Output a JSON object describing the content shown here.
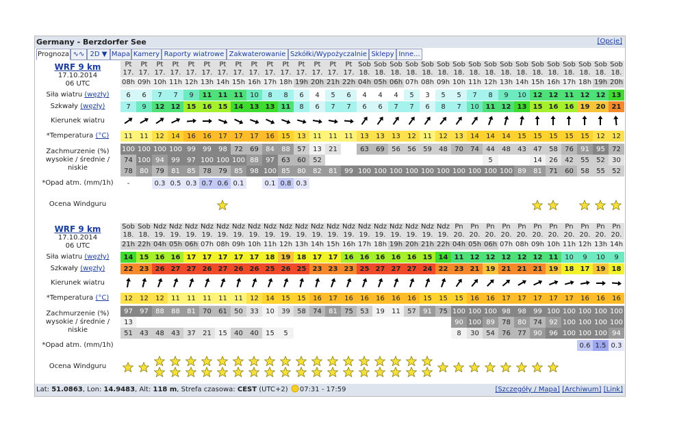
{
  "header": {
    "location": "Germany - Berzdorfer See",
    "options_link": "[Opcje]"
  },
  "tabs": [
    {
      "label": "Prognoza",
      "w": 48,
      "active": true
    },
    {
      "label": "∿∿",
      "w": 22,
      "active": false
    },
    {
      "label": "2D ▼",
      "w": 32,
      "active": false
    },
    {
      "label": "Mapa",
      "w": 29,
      "active": false
    },
    {
      "label": "Kamery",
      "w": 42,
      "active": false
    },
    {
      "label": "Raporty wiatrowe",
      "w": 93,
      "active": false
    },
    {
      "label": "Zakwaterowanie",
      "w": 88,
      "active": false
    },
    {
      "label": "Szkółki/Wypożyczalnie",
      "w": 116,
      "active": false
    },
    {
      "label": "Sklepy",
      "w": 38,
      "active": false
    },
    {
      "label": "Inne...",
      "w": 36,
      "active": false
    }
  ],
  "labels": {
    "wind": "Siła wiatru",
    "wind_unit": "(węzły)",
    "gust": "Szkwały",
    "gust_unit": "(węzły)",
    "dir": "Kierunek wiatru",
    "temp": "*Temperatura",
    "temp_unit": "(°C)",
    "cloud1": "Zachmurzenie (%)",
    "cloud2": "wysokie / średnie / niskie",
    "precip": "*Opad atm. (mm/1h)",
    "rating": "Ocena Windguru"
  },
  "blocks": [
    {
      "model": "WRF 9 km",
      "date": "17.10.2014",
      "run": "06 UTC",
      "days": [
        "Pt",
        "Pt",
        "Pt",
        "Pt",
        "Pt",
        "Pt",
        "Pt",
        "Pt",
        "Pt",
        "Pt",
        "Pt",
        "Pt",
        "Pt",
        "Pt",
        "Pt",
        "Sob",
        "Sob",
        "Sob",
        "Sob",
        "Sob",
        "Sob",
        "Sob",
        "Sob",
        "Sob",
        "Sob",
        "Sob",
        "Sob",
        "Sob",
        "Sob",
        "Sob",
        "Sob",
        "Sob"
      ],
      "dates": [
        "17.",
        "17.",
        "17.",
        "17.",
        "17.",
        "17.",
        "17.",
        "17.",
        "17.",
        "17.",
        "17.",
        "17.",
        "17.",
        "17.",
        "17.",
        "18.",
        "18.",
        "18.",
        "18.",
        "18.",
        "18.",
        "18.",
        "18.",
        "18.",
        "18.",
        "18.",
        "18.",
        "18.",
        "18.",
        "18.",
        "18.",
        "18."
      ],
      "hours": [
        "08h",
        "09h",
        "10h",
        "11h",
        "12h",
        "13h",
        "14h",
        "15h",
        "16h",
        "17h",
        "18h",
        "19h",
        "20h",
        "21h",
        "22h",
        "04h",
        "05h",
        "06h",
        "07h",
        "08h",
        "09h",
        "10h",
        "11h",
        "12h",
        "13h",
        "14h",
        "15h",
        "16h",
        "17h",
        "18h",
        "19h",
        "20h"
      ],
      "wind": [
        "6",
        "6",
        "7",
        "7",
        "9",
        "11",
        "11",
        "11",
        "10",
        "8",
        "8",
        "6",
        "4",
        "5",
        "6",
        "4",
        "4",
        "4",
        "5",
        "3",
        "5",
        "5",
        "7",
        "8",
        "9",
        "10",
        "12",
        "12",
        "11",
        "12",
        "12",
        "13"
      ],
      "gust": [
        "7",
        "9",
        "12",
        "12",
        "15",
        "16",
        "15",
        "14",
        "13",
        "13",
        "11",
        "8",
        "6",
        "7",
        "7",
        "6",
        "6",
        "7",
        "7",
        "6",
        "8",
        "7",
        "10",
        "11",
        "12",
        "13",
        "15",
        "16",
        "16",
        "19",
        "20",
        "21"
      ],
      "dir": [
        235,
        240,
        235,
        245,
        265,
        270,
        290,
        295,
        290,
        295,
        290,
        285,
        280,
        280,
        275,
        215,
        215,
        215,
        215,
        215,
        220,
        215,
        215,
        200,
        195,
        190,
        180,
        180,
        180,
        180,
        180,
        175
      ],
      "temp": [
        "11",
        "11",
        "12",
        "14",
        "16",
        "16",
        "17",
        "17",
        "17",
        "16",
        "15",
        "13",
        "11",
        "11",
        "11",
        "13",
        "13",
        "13",
        "12",
        "11",
        "12",
        "13",
        "14",
        "14",
        "14",
        "15",
        "15",
        "15",
        "15",
        "15",
        "12",
        "12"
      ],
      "cloud_h": [
        "100",
        "100",
        "100",
        "100",
        "99",
        "99",
        "98",
        "72",
        "69",
        "84",
        "88",
        "57",
        "13",
        "21",
        "",
        "63",
        "69",
        "56",
        "56",
        "59",
        "48",
        "70",
        "74",
        "44",
        "48",
        "43",
        "47",
        "58",
        "76",
        "91",
        "95",
        "72"
      ],
      "cloud_m": [
        "74",
        "100",
        "94",
        "99",
        "97",
        "100",
        "100",
        "100",
        "88",
        "97",
        "63",
        "60",
        "52",
        "",
        "",
        "",
        "",
        "",
        "",
        "",
        "",
        "",
        "",
        "5",
        "",
        "",
        "14",
        "26",
        "42",
        "55",
        "52",
        "30"
      ],
      "cloud_l": [
        "78",
        "80",
        "79",
        "81",
        "85",
        "78",
        "79",
        "85",
        "98",
        "100",
        "85",
        "80",
        "82",
        "81",
        "99",
        "100",
        "100",
        "100",
        "100",
        "100",
        "100",
        "100",
        "100",
        "100",
        "100",
        "89",
        "81",
        "71",
        "60",
        "58",
        "55",
        "52"
      ],
      "precip": [
        "-",
        "",
        "0.3",
        "0.5",
        "0.3",
        "0.7",
        "0.6",
        "0.1",
        "",
        "0.1",
        "0.8",
        "0.3",
        "",
        "",
        "",
        "",
        "",
        "",
        "",
        "",
        "",
        "",
        "",
        "",
        "",
        "",
        "",
        "",
        "",
        "",
        "",
        ""
      ],
      "rating": [
        0,
        0,
        0,
        0,
        0,
        0,
        1,
        0,
        0,
        0,
        0,
        0,
        0,
        0,
        0,
        0,
        0,
        0,
        0,
        0,
        0,
        0,
        0,
        0,
        0,
        0,
        1,
        1,
        0,
        1,
        1,
        1
      ]
    },
    {
      "model": "WRF 9 km",
      "date": "17.10.2014",
      "run": "06 UTC",
      "days": [
        "Sob",
        "Sob",
        "Ndz",
        "Ndz",
        "Ndz",
        "Ndz",
        "Ndz",
        "Ndz",
        "Ndz",
        "Ndz",
        "Ndz",
        "Ndz",
        "Ndz",
        "Ndz",
        "Ndz",
        "Ndz",
        "Ndz",
        "Ndz",
        "Ndz",
        "Ndz",
        "Ndz",
        "Pn",
        "Pn",
        "Pn",
        "Pn",
        "Pn",
        "Pn",
        "Pn",
        "Pn",
        "Pn",
        "Pn",
        "Pn"
      ],
      "dates": [
        "18.",
        "18.",
        "19.",
        "19.",
        "19.",
        "19.",
        "19.",
        "19.",
        "19.",
        "19.",
        "19.",
        "19.",
        "19.",
        "19.",
        "19.",
        "19.",
        "19.",
        "19.",
        "19.",
        "19.",
        "19.",
        "20.",
        "20.",
        "20.",
        "20.",
        "20.",
        "20.",
        "20.",
        "20.",
        "20.",
        "20.",
        "20."
      ],
      "hours": [
        "21h",
        "22h",
        "04h",
        "05h",
        "06h",
        "07h",
        "08h",
        "09h",
        "10h",
        "11h",
        "12h",
        "13h",
        "14h",
        "15h",
        "16h",
        "17h",
        "18h",
        "19h",
        "20h",
        "21h",
        "22h",
        "04h",
        "05h",
        "06h",
        "07h",
        "08h",
        "09h",
        "10h",
        "11h",
        "12h",
        "13h",
        "14h"
      ],
      "wind": [
        "14",
        "15",
        "16",
        "16",
        "17",
        "17",
        "17",
        "17",
        "17",
        "18",
        "19",
        "18",
        "17",
        "17",
        "16",
        "16",
        "16",
        "16",
        "16",
        "15",
        "14",
        "11",
        "12",
        "12",
        "12",
        "12",
        "12",
        "11",
        "10",
        "9",
        "10",
        "9"
      ],
      "gust": [
        "22",
        "23",
        "26",
        "27",
        "27",
        "26",
        "27",
        "26",
        "26",
        "25",
        "26",
        "25",
        "23",
        "23",
        "23",
        "25",
        "27",
        "27",
        "27",
        "24",
        "22",
        "23",
        "21",
        "19",
        "21",
        "21",
        "21",
        "19",
        "18",
        "17",
        "19",
        "18"
      ],
      "dir": [
        190,
        195,
        200,
        200,
        200,
        200,
        200,
        195,
        200,
        200,
        200,
        195,
        195,
        200,
        200,
        200,
        200,
        200,
        200,
        200,
        200,
        215,
        220,
        225,
        230,
        240,
        245,
        250,
        255,
        260,
        270,
        275
      ],
      "temp": [
        "12",
        "12",
        "12",
        "11",
        "11",
        "11",
        "11",
        "11",
        "12",
        "14",
        "15",
        "15",
        "16",
        "17",
        "16",
        "16",
        "16",
        "16",
        "16",
        "15",
        "15",
        "15",
        "16",
        "16",
        "17",
        "17",
        "17",
        "17",
        "17",
        "16",
        "16",
        "16"
      ],
      "cloud_h": [
        "97",
        "97",
        "88",
        "88",
        "81",
        "70",
        "61",
        "50",
        "33",
        "10",
        "39",
        "58",
        "74",
        "81",
        "75",
        "53",
        "19",
        "11",
        "57",
        "91",
        "75",
        "100",
        "100",
        "100",
        "98",
        "98",
        "99",
        "100",
        "100",
        "100",
        "100",
        "100"
      ],
      "cloud_m": [
        "13",
        "",
        "",
        "",
        "",
        "",
        "",
        "",
        "",
        "",
        "",
        "",
        "",
        "",
        "",
        "",
        "",
        "",
        "",
        "",
        "",
        "90",
        "100",
        "89",
        "78",
        "80",
        "74",
        "92",
        "100",
        "100",
        "100",
        "100"
      ],
      "cloud_l": [
        "51",
        "43",
        "48",
        "43",
        "37",
        "21",
        "15",
        "40",
        "40",
        "15",
        "5",
        "",
        "",
        "",
        "",
        "",
        "",
        "",
        "",
        "",
        "",
        "8",
        "30",
        "54",
        "76",
        "77",
        "90",
        "96",
        "100",
        "100",
        "100",
        "94"
      ],
      "precip": [
        "",
        "",
        "",
        "",
        "",
        "",
        "",
        "",
        "",
        "",
        "",
        "",
        "",
        "",
        "",
        "",
        "",
        "",
        "",
        "",
        "",
        "",
        "",
        "",
        "",
        "",
        "",
        "",
        "",
        "0.6",
        "1.5",
        "0.3"
      ],
      "rating": [
        1,
        1,
        2,
        2,
        2,
        2,
        2,
        2,
        2,
        2,
        2,
        2,
        2,
        2,
        2,
        2,
        2,
        2,
        2,
        2,
        1,
        1,
        1,
        1,
        1,
        1,
        1,
        1,
        0,
        0,
        0,
        0
      ]
    }
  ],
  "footer": {
    "lat_label": "Lat:",
    "lat": "51.0863",
    "lon_label": ", Lon:",
    "lon": "14.9483",
    "alt_label": ", Alt:",
    "alt": "118 m",
    "tz_label": ", Strefa czasowa:",
    "tz": "CEST",
    "tz_off": "(UTC+2)",
    "sun": "07:31 - 17:59",
    "link1": "[Szczegóły / Mapa]",
    "link2": "[Archiwum]",
    "link3": "[Link]"
  },
  "colors": {
    "wind_scale": [
      "#ffffff",
      "#c7f5f5",
      "#99f0e8",
      "#63e8a6",
      "#4ee44f",
      "#9cf034",
      "#f0f030",
      "#f5c63a",
      "#f58c2a",
      "#ef4b2a"
    ]
  }
}
